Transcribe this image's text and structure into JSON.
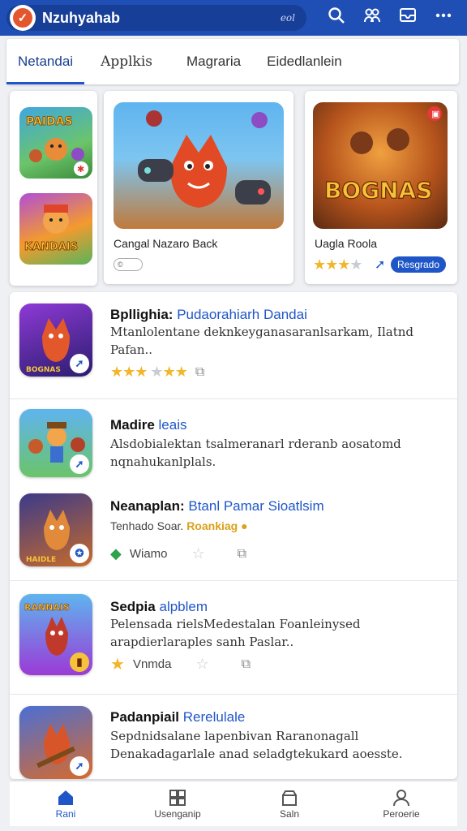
{
  "app": {
    "brand": "Nzuhyahab",
    "search_hint": "eol",
    "icons": [
      "search-icon",
      "people-icon",
      "inbox-icon",
      "more-icon"
    ]
  },
  "tabs": [
    {
      "label": "Netandai",
      "active": true
    },
    {
      "label": "Applkis",
      "active": false
    },
    {
      "label": "Magraria",
      "active": false
    },
    {
      "label": "Eidedlanlein",
      "active": false
    }
  ],
  "featured": {
    "card1": {
      "title": "Cangal Nazaro Back",
      "toggle": "©"
    },
    "card2": {
      "title": "Uagla Roola",
      "poster_text": "BOGNAS",
      "rating": 3,
      "button": "Resgrado"
    }
  },
  "list": [
    {
      "title_bold": "Bpllighia:",
      "title_blue": "Pudaorahiarh Dandai",
      "desc": "Mtanlolentane deknkeyganasaranlsarkam, Ilatnd Pafan..",
      "rating": 4.5
    },
    {
      "title_bold": "Madire",
      "title_blue": "leais",
      "desc": "Alsdobialektan tsalmeranarl rderanb aosatomd nqnahukanlplals."
    },
    {
      "title_bold": "Neanaplan:",
      "title_blue": "Btanl Pamar Sioatlsim",
      "sub_plain": "Tenhado Soar.",
      "sub_gold": "Roankiag",
      "meta_label": "Wiamo"
    },
    {
      "title_bold": "Sedpia",
      "title_blue": "alpblem",
      "desc": "Pelensada rielsMedestalan Foanleinysed arapdierlaraples sanh Paslar..",
      "meta_label": "Vnmda"
    },
    {
      "title_bold": "Padanpiail",
      "title_blue": "Rerelulale",
      "desc": "Sepdnidsalane lapenbivan Raranonagall Denakadagarlale anad seladgtekukard aoesste."
    }
  ],
  "bottom_nav": [
    {
      "label": "Rani",
      "icon": "home-icon",
      "active": true
    },
    {
      "label": "Usenganip",
      "icon": "grid-icon",
      "active": false
    },
    {
      "label": "Saln",
      "icon": "store-icon",
      "active": false
    },
    {
      "label": "Peroerie",
      "icon": "person-icon",
      "active": false
    }
  ],
  "colors": {
    "primary": "#1f56c7",
    "topbar": "#1f4fb5",
    "star": "#f2b62a"
  }
}
